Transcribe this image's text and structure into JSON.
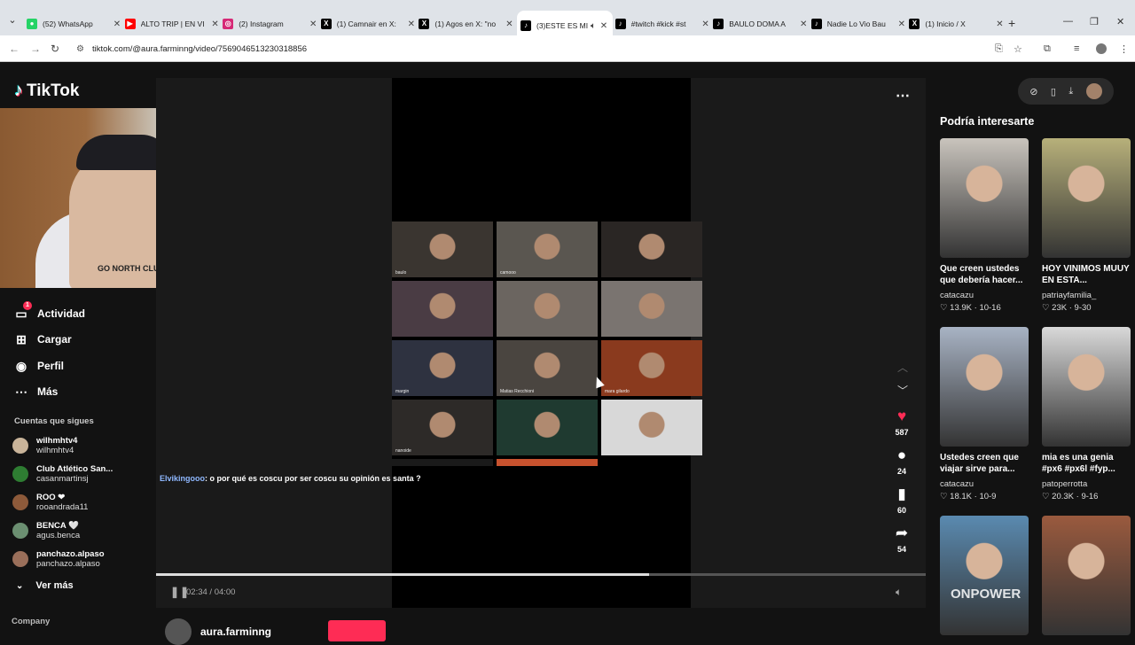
{
  "browser": {
    "tabs": [
      {
        "label": "(52) WhatsApp",
        "icon": "whatsapp-icon",
        "color": "#25d366",
        "glyph": "●"
      },
      {
        "label": "ALTO TRIP | EN VI",
        "icon": "youtube-icon",
        "color": "#ff0000",
        "glyph": "▶"
      },
      {
        "label": "(2) Instagram",
        "icon": "instagram-icon",
        "color": "#d62976",
        "glyph": "◎"
      },
      {
        "label": "(1) Camnair en X:",
        "icon": "x-icon",
        "color": "#000000",
        "glyph": "X"
      },
      {
        "label": "(1) Agos en X: \"no",
        "icon": "x-icon",
        "color": "#000000",
        "glyph": "X"
      },
      {
        "label": "(3)ESTE ES MI",
        "icon": "tiktok-icon",
        "color": "#000000",
        "glyph": "♪"
      },
      {
        "label": "#twitch #kick #st",
        "icon": "tiktok-icon",
        "color": "#000000",
        "glyph": "♪"
      },
      {
        "label": "BAULO DOMA A",
        "icon": "tiktok-icon",
        "color": "#000000",
        "glyph": "♪"
      },
      {
        "label": "Nadie Lo Vio Bau",
        "icon": "tiktok-icon",
        "color": "#000000",
        "glyph": "♪"
      },
      {
        "label": "(1) Inicio / X",
        "icon": "x-icon",
        "color": "#000000",
        "glyph": "X"
      }
    ],
    "url": "tiktok.com/@aura.farminng/video/7569046513230318856"
  },
  "sidebar": {
    "logo": "TikTok",
    "menu": [
      {
        "label": "Actividad",
        "icon": "inbox-icon",
        "badge": "1"
      },
      {
        "label": "Cargar",
        "icon": "upload-icon"
      },
      {
        "label": "Perfil",
        "icon": "profile-icon"
      },
      {
        "label": "Más",
        "icon": "more-icon"
      }
    ],
    "following_title": "Cuentas que sigues",
    "accounts": [
      {
        "name": "wilhmhtv4",
        "user": "wilhmhtv4",
        "color": "#c9b49a"
      },
      {
        "name": "Club Atlético San...",
        "user": "casanmartinsj",
        "color": "#2e7d32"
      },
      {
        "name": "ROO ❤",
        "user": "rooandrada11",
        "color": "#8d5a3a"
      },
      {
        "name": "BENCA 🤍",
        "user": "agus.benca",
        "color": "#6b8f71"
      },
      {
        "name": "panchazo.alpaso",
        "user": "panchazo.alpaso",
        "color": "#9a6f5a"
      }
    ],
    "see_more": "Ver más",
    "company": "Company"
  },
  "webcam": {
    "shirt_text": "GO NORTH CLUB"
  },
  "video": {
    "chat_user": "Elvikingooo",
    "chat_message": ": o por qué es coscu por ser coscu su opinión es santa ?",
    "participants": [
      {
        "label": "baulo",
        "color": "#3a3530"
      },
      {
        "label": "camooo",
        "color": "#5a5650"
      },
      {
        "label": "",
        "color": "#2a2624"
      },
      {
        "label": "",
        "color": "#4a3c44"
      },
      {
        "label": "",
        "color": "#6b6560"
      },
      {
        "label": "",
        "color": "#7a7470"
      },
      {
        "label": "margin",
        "color": "#2e3240"
      },
      {
        "label": "Matias Recchioni",
        "color": "#4a4540"
      },
      {
        "label": "mara gilardo",
        "color": "#8a3a1e"
      },
      {
        "label": "nanoide",
        "color": "#2d2a28"
      },
      {
        "label": "",
        "color": "#1f3a30"
      },
      {
        "label": "",
        "color": "#d8d8d8"
      }
    ],
    "time": "02:34 / 04:00",
    "progress": 0.64,
    "likes": "587",
    "comments": "24",
    "saves": "60",
    "shares": "54",
    "author": "aura.farminng"
  },
  "recommendations": {
    "title": "Podría interesarte",
    "cards": [
      {
        "desc": "Que creen ustedes que debería hacer...",
        "author": "catacazu",
        "likes": "13.9K",
        "date": "10-16",
        "color": "#c9c4bd"
      },
      {
        "desc": "HOY VINIMOS MUUY EN ESTA...",
        "author": "patriayfamilia_",
        "likes": "23K",
        "date": "9-30",
        "color": "#b7b07a"
      },
      {
        "desc": "Ustedes creen que viajar sirve para...",
        "author": "catacazu",
        "likes": "18.1K",
        "date": "10-9",
        "color": "#a8b3c4"
      },
      {
        "desc": "mia es una genia #px6 #px6l #fyp...",
        "author": "patoperrotta",
        "likes": "20.3K",
        "date": "9-16",
        "color": "#d9d9d9"
      },
      {
        "desc": "",
        "author": "",
        "likes": "",
        "date": "",
        "color": "#5a8ab0"
      },
      {
        "desc": "",
        "author": "",
        "likes": "",
        "date": "",
        "color": "#9a5a3e"
      }
    ],
    "watermark": "ONPOWER"
  }
}
